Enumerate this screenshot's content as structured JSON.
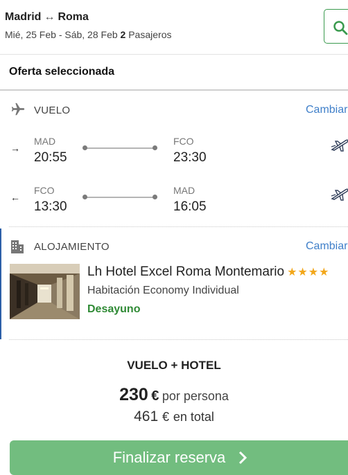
{
  "header": {
    "origin": "Madrid",
    "route_arrow": "↔",
    "destination": "Roma",
    "dates": "Mié, 25 Feb - Sáb, 28 Feb",
    "passenger_count": "2",
    "passengers_label": "Pasajeros"
  },
  "offer": {
    "title": "Oferta seleccionada"
  },
  "flight": {
    "label": "VUELO",
    "change_label": "Cambiar",
    "outbound": {
      "direction": "→",
      "from_code": "MAD",
      "from_time": "20:55",
      "to_code": "FCO",
      "to_time": "23:30"
    },
    "return": {
      "direction": "←",
      "from_code": "FCO",
      "from_time": "13:30",
      "to_code": "MAD",
      "to_time": "16:05"
    }
  },
  "hotel": {
    "label": "ALOJAMIENTO",
    "change_label": "Cambiar",
    "name": "Lh Hotel Excel Roma Montemario",
    "stars": "★★★★",
    "room": "Habitación Economy Individual",
    "meal": "Desayuno"
  },
  "summary": {
    "package_label": "VUELO + HOTEL",
    "price_per_person": "230",
    "currency": "€",
    "per_person_label": "por persona",
    "total": "461",
    "total_label": "en total",
    "cta_label": "Finalizar reserva"
  },
  "colors": {
    "accent_green": "#72bd7f",
    "link_blue": "#3f7fc9",
    "meal_green": "#2f8a35",
    "star_gold": "#f2a71b",
    "section_accent": "#2c5fa8"
  },
  "icons": {
    "search": "search-icon",
    "flight": "airplane-icon",
    "hotel": "building-icon",
    "flight_detail": "airline-logo-icon",
    "cta": "chevron-right-icon"
  }
}
